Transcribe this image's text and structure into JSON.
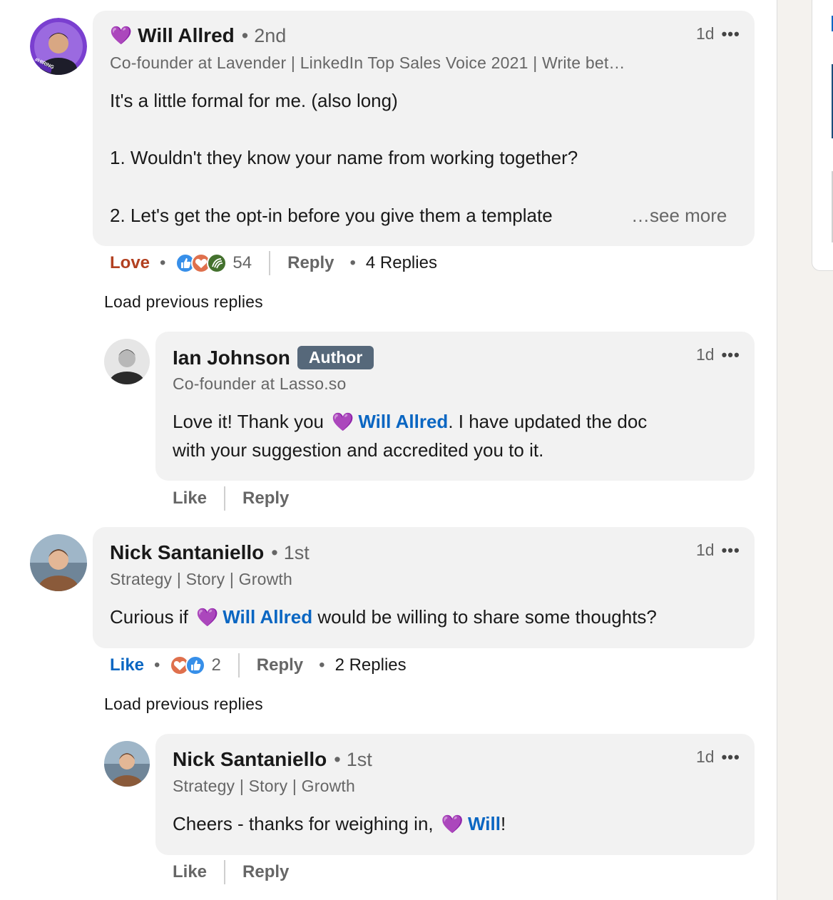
{
  "comments": [
    {
      "author": "Will Allred",
      "degree": "2nd",
      "headline": "Co-founder at Lavender | LinkedIn Top Sales Voice 2021 | Write bet…",
      "time": "1d",
      "lines": [
        "It's a little formal for me. (also long)",
        "1. Wouldn't they know your name from working together?",
        "2. Let's get the opt-in before you give them a template"
      ],
      "see_more": "…see more",
      "action_reaction": "Love",
      "reaction_count": "54",
      "reply_label": "Reply",
      "replies": "4 Replies",
      "avatar_badge": "#HIRING"
    },
    {
      "author": "Ian Johnson",
      "badge": "Author",
      "headline": "Co-founder at Lasso.so",
      "time": "1d",
      "text_before": "Love it! Thank you",
      "mention": "Will Allred",
      "text_after": ". I have updated the doc",
      "line2": "with your suggestion and accredited you to it.",
      "like_label": "Like",
      "reply_label": "Reply"
    },
    {
      "author": "Nick Santaniello",
      "degree": "1st",
      "headline": "Strategy | Story | Growth",
      "time": "1d",
      "text_before": "Curious if",
      "mention": "Will Allred",
      "text_after": "would be willing to share some thoughts?",
      "action_reaction": "Like",
      "reaction_count": "2",
      "reply_label": "Reply",
      "replies": "2 Replies"
    },
    {
      "author": "Nick Santaniello",
      "degree": "1st",
      "headline": "Strategy | Story | Growth",
      "time": "1d",
      "text_before": "Cheers - thanks for weighing in,",
      "mention": "Will",
      "text_after": "!",
      "like_label": "Like",
      "reply_label": "Reply"
    }
  ],
  "load_previous": "Load previous replies",
  "more_icon": "•••",
  "heart_emoji": "💜",
  "degree_dot": "•",
  "colors": {
    "mention": "#0a66c2",
    "love": "#b24020",
    "bubble": "#f2f2f2",
    "author_badge": "#56687a"
  }
}
